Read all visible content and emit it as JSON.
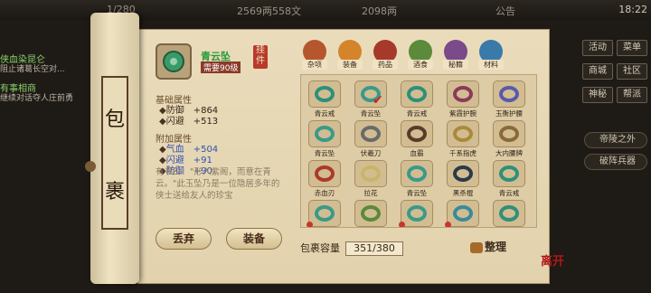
{
  "topbar": {
    "resource1": "1/280",
    "money": "2569两558文",
    "gold": "2098两",
    "notice": "公告",
    "time": "18:22"
  },
  "quests": [
    {
      "title": "侠血染昆仑",
      "desc": "阻止诸葛长空对..."
    },
    {
      "title": "有事相商",
      "desc": "继续对话夺人庄前勇"
    }
  ],
  "right_menu": {
    "buttons": [
      "活动",
      "菜单",
      "商城",
      "社区",
      "神秘",
      "帮派"
    ],
    "tags": [
      "帝陵之外",
      "破阵兵器"
    ]
  },
  "bag_title": [
    "包",
    "裹"
  ],
  "item": {
    "name": "青云坠",
    "requirement": "需要90级",
    "guajian": "挂件",
    "base_title": "基础属性",
    "base_attrs": [
      {
        "label": "防御",
        "value": "+864"
      },
      {
        "label": "闪避",
        "value": "+513"
      }
    ],
    "extra_title": "附加属性",
    "extra_attrs": [
      {
        "label": "气血",
        "value": "+504"
      },
      {
        "label": "闪避",
        "value": "+91"
      },
      {
        "label": "防御",
        "value": "+90"
      }
    ],
    "description": "有书曰：\"形入紫阁，而意在青云。\"此玉坠乃是一位隐居多年的侠士送给友人的珍宝"
  },
  "buttons": {
    "discard": "丢弃",
    "equip": "装备"
  },
  "tabs": [
    {
      "label": "杂项",
      "color": "#b5562e"
    },
    {
      "label": "装备",
      "color": "#d4842a"
    },
    {
      "label": "药品",
      "color": "#a63a2a"
    },
    {
      "label": "酒食",
      "color": "#5a8a3a"
    },
    {
      "label": "秘籍",
      "color": "#7a4a8a"
    },
    {
      "label": "材料",
      "color": "#3a7aaa"
    }
  ],
  "grid_items": [
    {
      "name": "青云戒",
      "color": "#2f8f7a",
      "red": false,
      "check": false
    },
    {
      "name": "青云坠",
      "color": "#3a9a8a",
      "red": false,
      "check": true
    },
    {
      "name": "青云戒",
      "color": "#2f8f7a",
      "red": false,
      "check": false
    },
    {
      "name": "紫霞护腕",
      "color": "#8a3a5a",
      "red": false,
      "check": false
    },
    {
      "name": "玉衡护腰",
      "color": "#5a5aaa",
      "red": false,
      "check": false
    },
    {
      "name": "青云坠",
      "color": "#3a9a8a",
      "red": false,
      "check": false
    },
    {
      "name": "伏羲刀",
      "color": "#6a6a6a",
      "red": false,
      "check": false
    },
    {
      "name": "血霸",
      "color": "#5a3a2a",
      "red": false,
      "check": false
    },
    {
      "name": "千系指虎",
      "color": "#aa8a3a",
      "red": false,
      "check": false
    },
    {
      "name": "大内腰牌",
      "color": "#8a6a3a",
      "red": false,
      "check": false
    },
    {
      "name": "赤血刃",
      "color": "#aa3a2a",
      "red": false,
      "check": false
    },
    {
      "name": "拉花",
      "color": "#c9b46a",
      "red": false,
      "check": false
    },
    {
      "name": "青云坠",
      "color": "#3a9a8a",
      "red": false,
      "check": false
    },
    {
      "name": "黑杀棍",
      "color": "#2a3a4a",
      "red": false,
      "check": false
    },
    {
      "name": "青云戒",
      "color": "#2f8f7a",
      "red": false,
      "check": false
    },
    {
      "name": "",
      "color": "#3a9a8a",
      "red": true,
      "check": false
    },
    {
      "name": "",
      "color": "#5a8a3a",
      "red": false,
      "check": false
    },
    {
      "name": "",
      "color": "#3a9a8a",
      "red": true,
      "check": false
    },
    {
      "name": "",
      "color": "#3a8a9a",
      "red": true,
      "check": false
    },
    {
      "name": "",
      "color": "#2f8f7a",
      "red": false,
      "check": false
    }
  ],
  "capacity": {
    "label": "包裹容量",
    "value": "351/380"
  },
  "sort_label": "整理",
  "logo": "离开"
}
